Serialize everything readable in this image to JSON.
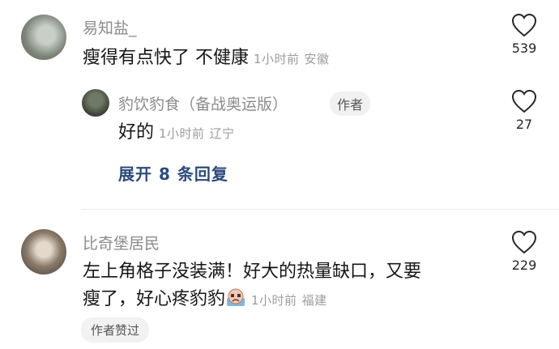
{
  "comments": [
    {
      "username": "易知盐_",
      "text": "瘦得有点快了 不健康",
      "time": "1小时前",
      "location": "安徽",
      "likes": "539",
      "icon": "heart-outline-icon",
      "replies": [
        {
          "username": "豹饮豹食（备战奥运版）",
          "badge": "作者",
          "text": "好的",
          "time": "1小时前",
          "location": "辽宁",
          "likes": "27",
          "icon": "heart-outline-icon"
        }
      ],
      "expand_label": "展开 8 条回复"
    },
    {
      "username": "比奇堡居民",
      "text_line1": "左上角格子没装满！好大的热量缺口，又要",
      "text_line2": "瘦了，好心疼豹豹",
      "emoji": "crying-face-emoji",
      "time": "1小时前",
      "location": "福建",
      "likes": "229",
      "icon": "heart-outline-icon",
      "liked_badge": "作者赞过"
    }
  ],
  "colors": {
    "username": "#8b8b8b",
    "text": "#161616",
    "meta": "#9c9c9c",
    "expand_link": "#2c4a7e",
    "badge_bg": "#f1f1f1"
  }
}
